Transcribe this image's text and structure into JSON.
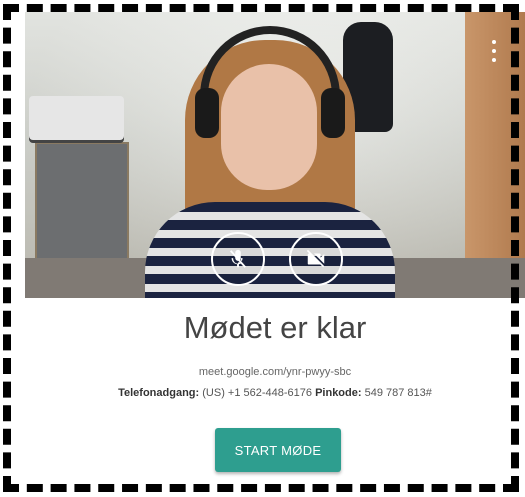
{
  "header": {
    "title": "Mødet er klar",
    "meeting_url": "meet.google.com/ynr-pwyy-sbc",
    "phone_label": "Telefonadgang:",
    "phone_value": "(US) +1 562-448-6176",
    "pin_label": "Pinkode:",
    "pin_value": "549 787 813#"
  },
  "actions": {
    "start_label": "START MØDE"
  },
  "controls": {
    "mic_icon": "mic-off-icon",
    "camera_icon": "camera-off-icon",
    "more_icon": "more-vert-icon"
  },
  "colors": {
    "accent": "#2e9e8f",
    "title_text": "#444444"
  }
}
